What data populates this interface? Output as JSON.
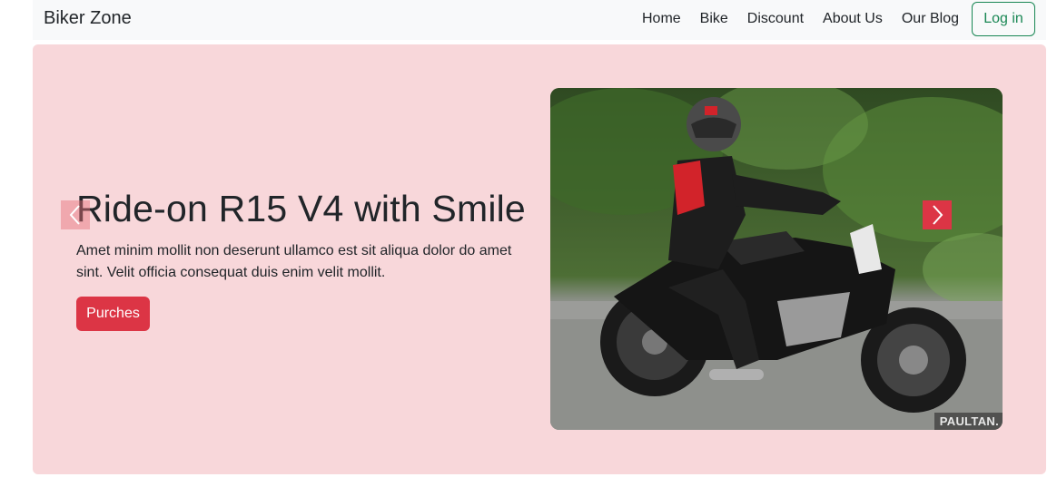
{
  "navbar": {
    "brand": "Biker Zone",
    "links": [
      "Home",
      "Bike",
      "Discount",
      "About Us",
      "Our Blog"
    ],
    "login_label": "Log in"
  },
  "hero": {
    "title": "Ride-on R15 V4 with Smile",
    "text": "Amet minim mollit non deserunt ullamco est sit aliqua dolor do amet sint. Velit officia consequat duis enim velit mollit.",
    "cta_label": "Purches",
    "image_watermark": "PAULTAN."
  },
  "colors": {
    "hero_bg": "#f8d7da",
    "accent_red": "#dc3545",
    "login_green": "#198754",
    "navbar_bg": "#f8f9fa"
  },
  "icons": {
    "prev": "chevron-left-icon",
    "next": "chevron-right-icon"
  }
}
